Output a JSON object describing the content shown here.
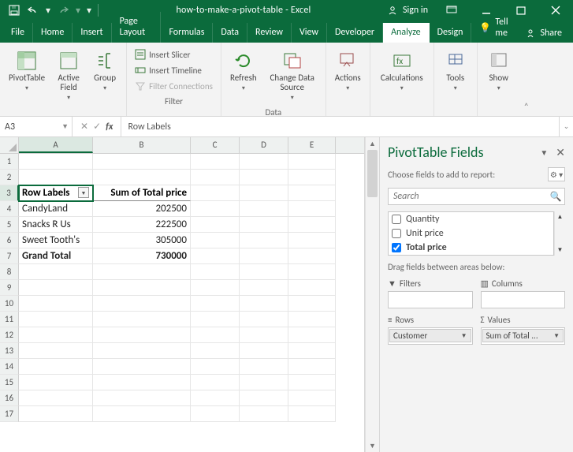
{
  "app": {
    "title": "how-to-make-a-pivot-table - Excel",
    "signin": "Sign in"
  },
  "tabs": {
    "file": "File",
    "items": [
      "Home",
      "Insert",
      "Page Layout",
      "Formulas",
      "Data",
      "Review",
      "View",
      "Developer"
    ],
    "ctx": [
      "Analyze",
      "Design"
    ],
    "active": "Analyze",
    "tellme": "Tell me",
    "share": "Share"
  },
  "ribbon": {
    "pivottable": "PivotTable",
    "activefield": "Active\nField",
    "group": "Group",
    "insert_slicer": "Insert Slicer",
    "insert_timeline": "Insert Timeline",
    "filter_connections": "Filter Connections",
    "filter_group_label": "Filter",
    "refresh": "Refresh",
    "change_data_source": "Change Data\nSource",
    "data_group_label": "Data",
    "actions": "Actions",
    "calculations": "Calculations",
    "tools": "Tools",
    "show": "Show"
  },
  "formula_bar": {
    "namebox": "A3",
    "value": "Row Labels"
  },
  "sheet": {
    "columns": [
      "A",
      "B",
      "C",
      "D",
      "E"
    ],
    "active_col": "A",
    "row_start": 1,
    "row_count": 17,
    "active_row": 3,
    "data": {
      "A3": "Row Labels",
      "B3": "Sum of Total price",
      "A4": "CandyLand",
      "B4": "202500",
      "A5": "Snacks R Us",
      "B5": "222500",
      "A6": "Sweet Tooth's",
      "B6": "305000",
      "A7": "Grand Total",
      "B7": "730000"
    }
  },
  "pane": {
    "title": "PivotTable Fields",
    "subtitle": "Choose fields to add to report:",
    "search_placeholder": "Search",
    "fields": [
      {
        "name": "Quantity",
        "checked": false
      },
      {
        "name": "Unit price",
        "checked": false
      },
      {
        "name": "Total price",
        "checked": true
      }
    ],
    "drag_label": "Drag fields between areas below:",
    "filters_label": "Filters",
    "columns_label": "Columns",
    "rows_label": "Rows",
    "values_label": "Values",
    "rows_value": "Customer",
    "values_value": "Sum of Total ..."
  }
}
